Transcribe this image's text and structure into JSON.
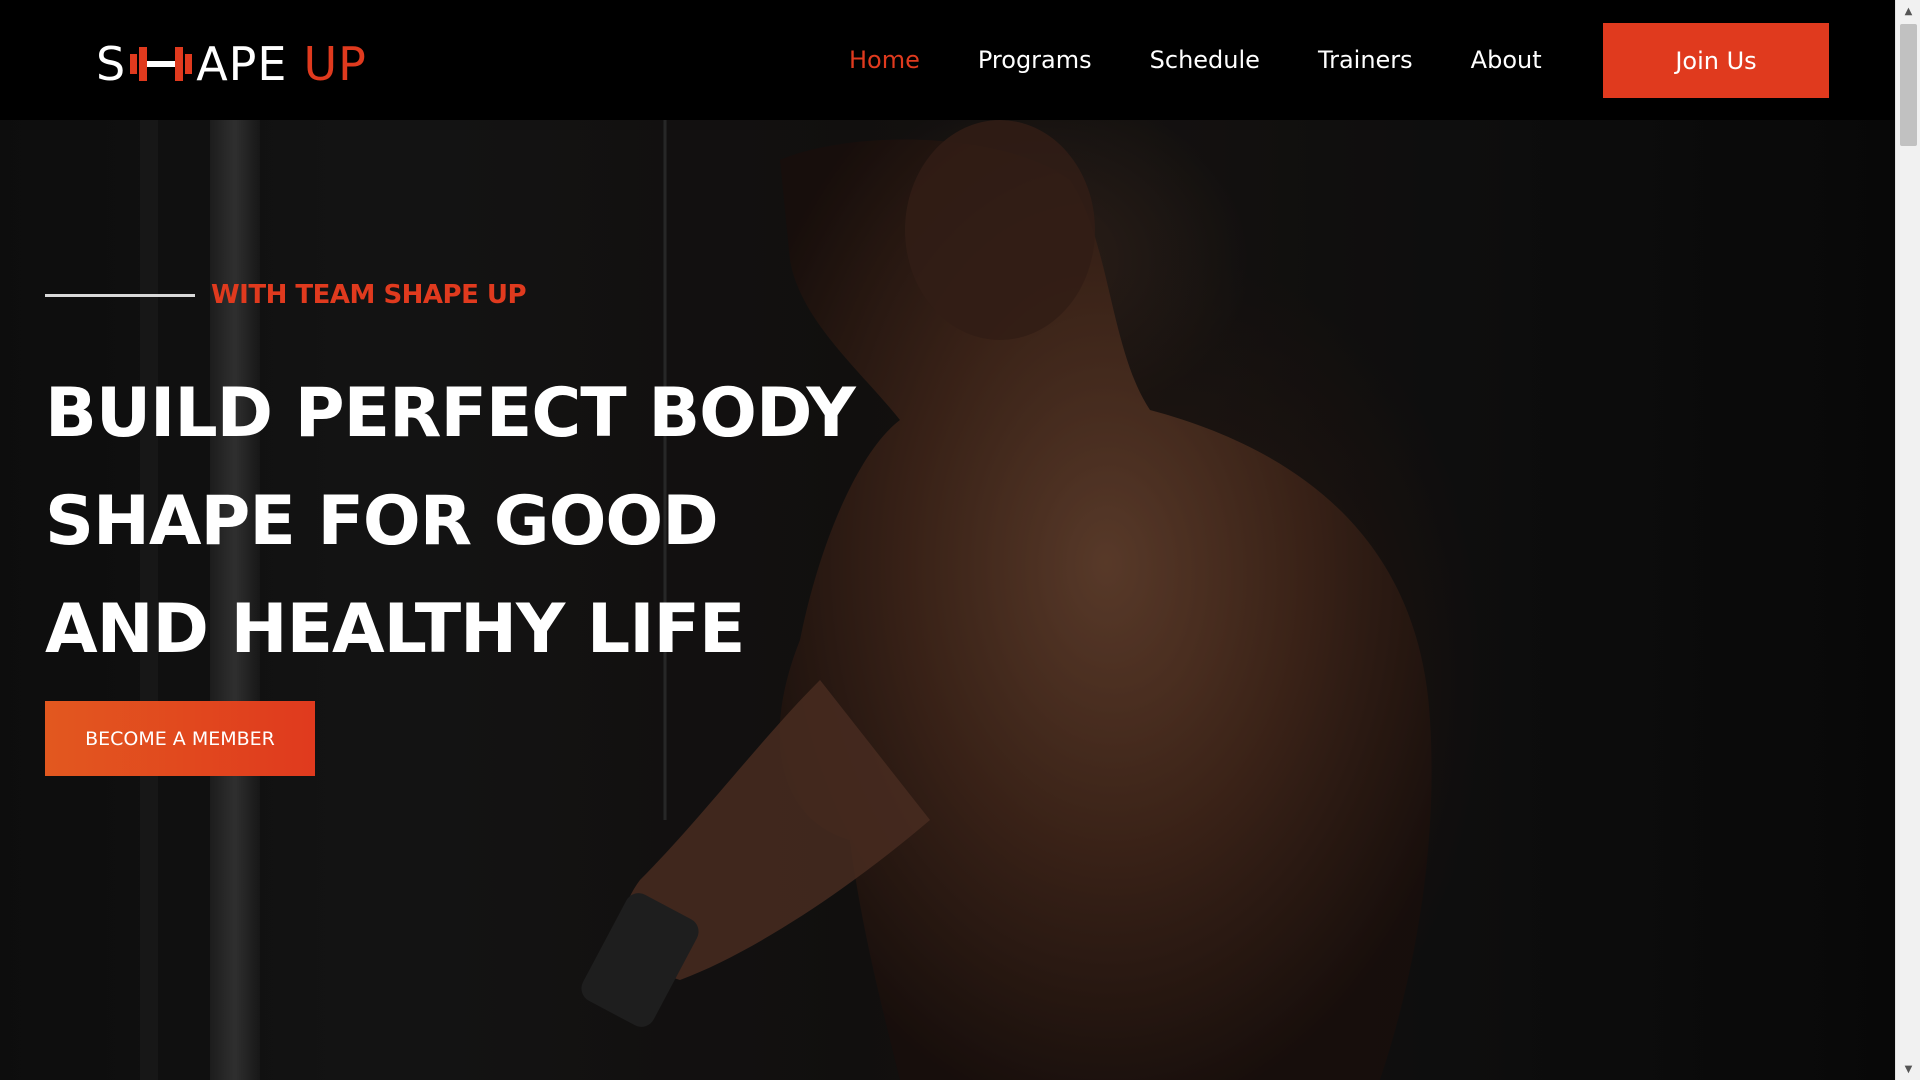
{
  "brand": {
    "logo_part1": "S",
    "logo_part2": "APE",
    "logo_part3": "UP",
    "accent_color": "#e03a1e"
  },
  "nav": {
    "items": [
      {
        "label": "Home",
        "active": true
      },
      {
        "label": "Programs",
        "active": false
      },
      {
        "label": "Schedule",
        "active": false
      },
      {
        "label": "Trainers",
        "active": false
      },
      {
        "label": "About",
        "active": false
      }
    ],
    "cta_label": "Join Us"
  },
  "hero": {
    "tagline": "WITH TEAM SHAPE UP",
    "headline_lines": [
      "BUILD PERFECT BODY",
      "SHAPE FOR GOOD",
      "AND HEALTHY LIFE"
    ],
    "cta_label": "BECOME A MEMBER",
    "background_image": "muscular man doing cable bicep curl in dark gym"
  },
  "scrollbar": {
    "up_icon": "chevron-up-icon",
    "down_icon": "chevron-down-icon"
  }
}
